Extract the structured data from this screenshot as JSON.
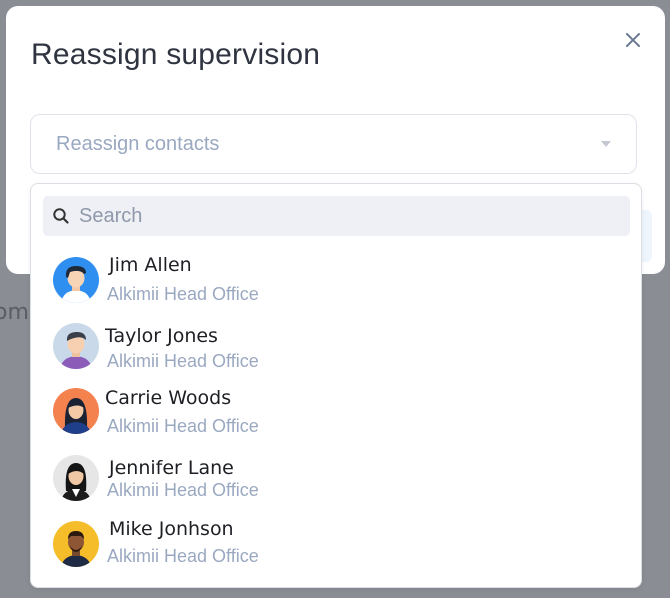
{
  "backdrop": {
    "fragment": "om"
  },
  "modal": {
    "title": "Reassign supervision",
    "close_icon": "close-icon"
  },
  "select": {
    "placeholder": "Reassign contacts",
    "caret_icon": "caret-down-icon"
  },
  "dropdown": {
    "search": {
      "placeholder": "Search",
      "value": "",
      "icon": "search-icon"
    },
    "items": [
      {
        "name": "Jim Allen",
        "office": "Alkimii Head Office",
        "avatar_bg": "#2f8ff0"
      },
      {
        "name": "Taylor Jones",
        "office": "Alkimii Head Office",
        "avatar_bg": "#c9d9ea"
      },
      {
        "name": "Carrie Woods",
        "office": "Alkimii Head Office",
        "avatar_bg": "#f3824f"
      },
      {
        "name": "Jennifer Lane",
        "office": "Alkimii Head Office",
        "avatar_bg": "#e6e6e6"
      },
      {
        "name": "Mike Jonhson",
        "office": "Alkimii Head Office",
        "avatar_bg": "#f5bd2a"
      }
    ]
  }
}
